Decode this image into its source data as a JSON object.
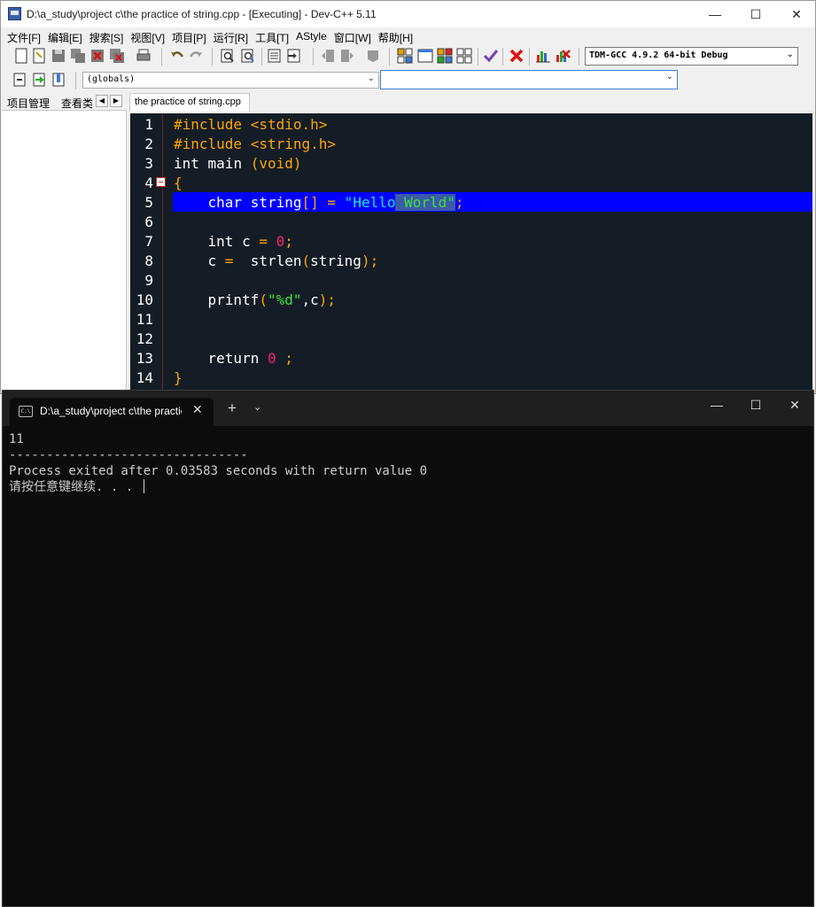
{
  "window": {
    "title": "D:\\a_study\\project  c\\the practice of string.cpp - [Executing] - Dev-C++ 5.11",
    "minimize": "—",
    "maximize": "☐",
    "close": "✕"
  },
  "menu": [
    "文件[F]",
    "编辑[E]",
    "搜索[S]",
    "视图[V]",
    "项目[P]",
    "运行[R]",
    "工具[T]",
    "AStyle",
    "窗口[W]",
    "帮助[H]"
  ],
  "toolbar": {
    "compiler": "TDM-GCC 4.9.2 64-bit Debug",
    "globals": "(globals)",
    "function": ""
  },
  "left_panel": {
    "tab_project": "项目管理",
    "tab_classes": "查看类"
  },
  "editor": {
    "file_tab": "the practice of string.cpp",
    "line_numbers": [
      "1",
      "2",
      "3",
      "4",
      "5",
      "6",
      "7",
      "8",
      "9",
      "10",
      "11",
      "12",
      "13",
      "14"
    ],
    "lines": {
      "l1": "#include <stdio.h>",
      "l2": "#include <string.h>",
      "l3_kw": "int",
      "l3_name": " main ",
      "l3_args": "(void)",
      "l4": "{",
      "l5_kw": "    char",
      "l5_name": " string",
      "l5_br": "[]",
      "l5_eq": " = ",
      "l5_q1": "\"",
      "l5_s1": "Hello",
      "l5_s2": " World",
      "l5_q2": "\"",
      "l5_end": ";",
      "l7_kw": "    int",
      "l7_rest": " c ",
      "l7_eq": "=",
      "l7_num": " 0",
      "l7_end": ";",
      "l8_a": "    c ",
      "l8_eq": "=",
      "l8_b": "  strlen",
      "l8_p1": "(",
      "l8_c": "string",
      "l8_p2": ");",
      "l10_a": "    printf",
      "l10_p1": "(",
      "l10_str": "\"%d\"",
      "l10_b": ",c",
      "l10_p2": ");",
      "l13_kw": "    return",
      "l13_num": " 0",
      "l13_end": " ;",
      "l14": "}"
    }
  },
  "terminal": {
    "tab_title": "D:\\a_study\\project  c\\the practice of string.cpp",
    "tab_icon": "C:\\",
    "new_tab": "+",
    "dropdown": "⌄",
    "minimize": "—",
    "maximize": "☐",
    "close": "✕",
    "output": [
      "11",
      "--------------------------------",
      "Process exited after 0.03583 seconds with return value 0",
      "请按任意键继续. . . "
    ]
  },
  "colors": {
    "editor_bg": "#141d26",
    "selection": "#0000ff",
    "preprocessor": "#ffa500",
    "number": "#ff1c70",
    "string": "#3ee33e",
    "terminal_bg": "#0c0c0c"
  }
}
